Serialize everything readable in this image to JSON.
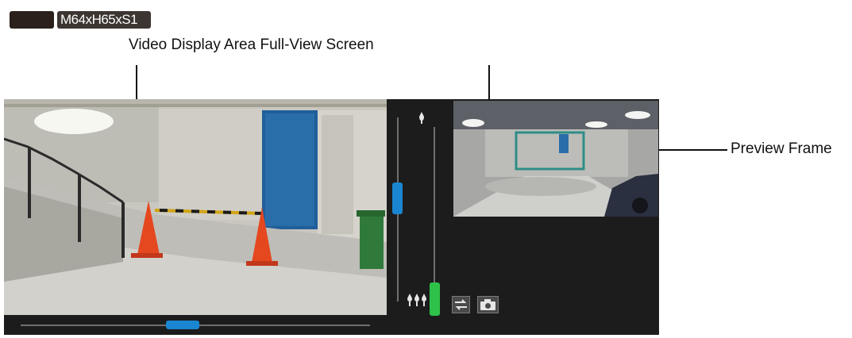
{
  "header": {
    "dark_tag": "",
    "model_tag": "M64xH65xS1"
  },
  "labels": {
    "video_area": "Video Display Area Full-View Screen",
    "preview_frame": "Preview Frame"
  },
  "controls": {
    "horizontal_slider_position": 0.47,
    "zoom_slider_position": 0.45,
    "focus_slider_position": 0.97,
    "icons": [
      "tele-icon",
      "wide-icon",
      "swap-view-icon",
      "snapshot-icon"
    ]
  },
  "colors": {
    "accent_blue": "#1a86d1",
    "accent_green": "#2ec24a",
    "preview_frame": "#2f8d87",
    "panel_bg": "#1c1c1c"
  }
}
